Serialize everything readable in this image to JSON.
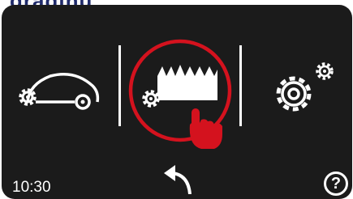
{
  "header_fragment": "gradinu",
  "status": {
    "clock": "10:30"
  },
  "menu": {
    "items": [
      {
        "id": "mower-settings",
        "icon": "mower-gear-icon"
      },
      {
        "id": "cutting-height",
        "icon": "grass-height-gear-icon",
        "selected": true
      },
      {
        "id": "general-settings",
        "icon": "gears-icon"
      }
    ]
  },
  "nav": {
    "back_icon": "back-arrow-icon"
  },
  "help": {
    "label": "?"
  },
  "colors": {
    "accent": "#d4121e",
    "screen": "#1b1b1b",
    "foreground": "#ffffff"
  }
}
